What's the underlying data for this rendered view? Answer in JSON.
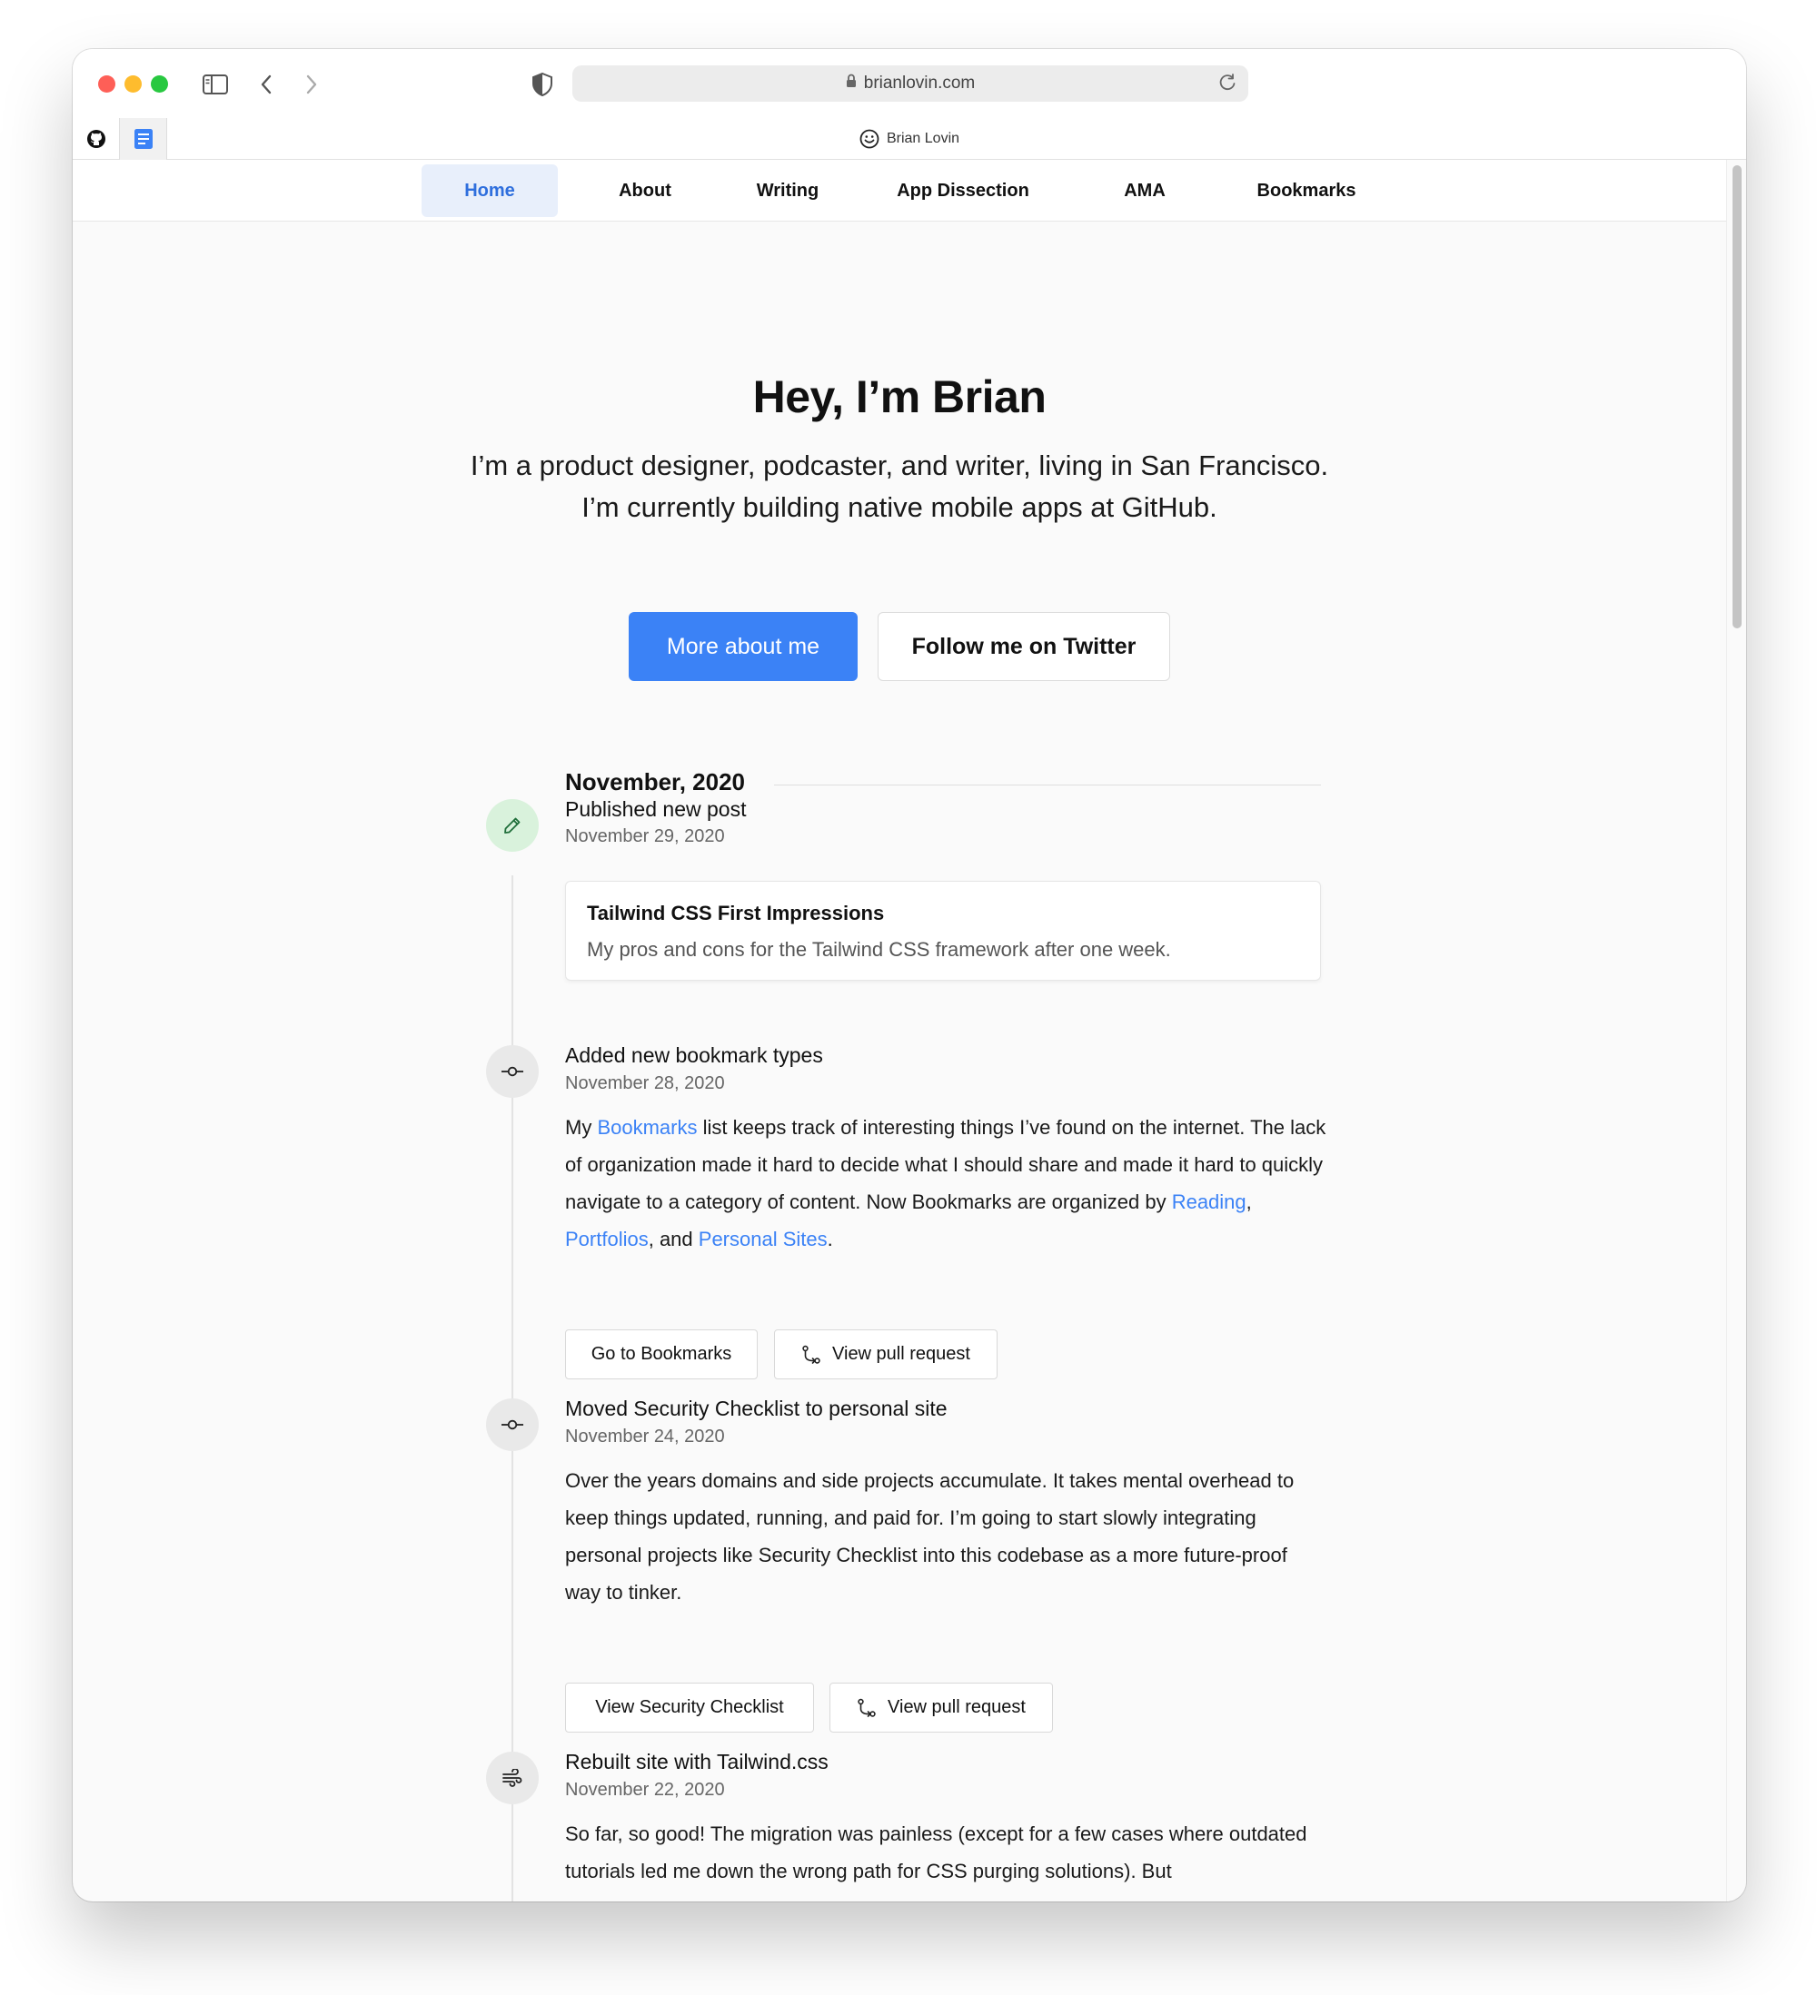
{
  "browser": {
    "url": "brianlovin.com",
    "tab_title": "Brian Lovin"
  },
  "nav": {
    "items": [
      {
        "label": "Home",
        "active": true
      },
      {
        "label": "About",
        "active": false
      },
      {
        "label": "Writing",
        "active": false
      },
      {
        "label": "App Dissection",
        "active": false
      },
      {
        "label": "AMA",
        "active": false
      },
      {
        "label": "Bookmarks",
        "active": false
      }
    ]
  },
  "hero": {
    "title": "Hey, I’m Brian",
    "subtitle": "I’m a product designer, podcaster, and writer, living in San Francisco. I’m currently building native mobile apps at GitHub.",
    "primary_button": "More about me",
    "secondary_button": "Follow me on Twitter"
  },
  "timeline": {
    "month": "November, 2020",
    "entries": [
      {
        "icon": "pencil-icon",
        "title": "Published new post",
        "date": "November 29, 2020",
        "card": {
          "title": "Tailwind CSS First Impressions",
          "description": "My pros and cons for the Tailwind CSS framework after one week."
        }
      },
      {
        "icon": "commit-icon",
        "title": "Added new bookmark types",
        "date": "November 28, 2020",
        "body": {
          "p1": "My ",
          "link1": "Bookmarks",
          "p2": " list keeps track of interesting things I’ve found on the internet. The lack of organization made it hard to decide what I should share and made it hard to quickly navigate to a category of content. Now Bookmarks are organized by ",
          "link2": "Reading",
          "p3": ", ",
          "link3": "Portfolios",
          "p4": ", and ",
          "link4": "Personal Sites",
          "p5": "."
        },
        "buttons": [
          "Go to Bookmarks",
          "View pull request"
        ]
      },
      {
        "icon": "commit-icon",
        "title": "Moved Security Checklist to personal site",
        "date": "November 24, 2020",
        "body": "Over the years domains and side projects accumulate. It takes mental overhead to keep things updated, running, and paid for. I’m going to start slowly integrating personal projects like Security Checklist into this codebase as a more future-proof way to tinker.",
        "buttons": [
          "View Security Checklist",
          "View pull request"
        ]
      },
      {
        "icon": "wind-icon",
        "title": "Rebuilt site with Tailwind.css",
        "date": "November 22, 2020",
        "body": "So far, so good! The migration was painless (except for a few cases where outdated tutorials led me down the wrong path for CSS purging solutions). But"
      }
    ]
  }
}
